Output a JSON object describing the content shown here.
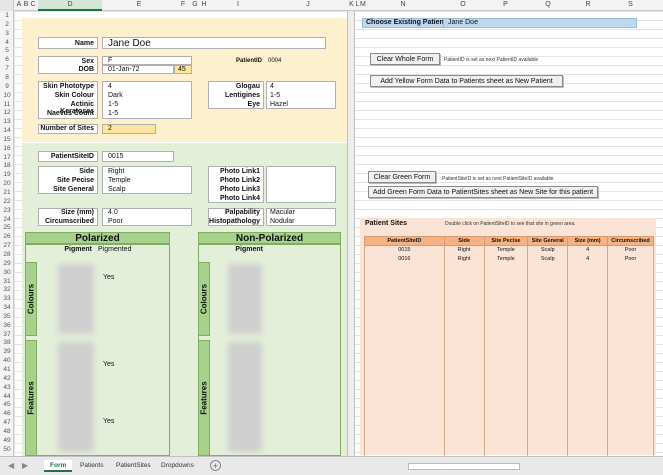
{
  "columns": [
    "A",
    "B",
    "C",
    "D",
    "E",
    "F",
    "G",
    "H",
    "I",
    "J",
    "K",
    "L",
    "M",
    "N",
    "O",
    "P",
    "Q",
    "R",
    "S"
  ],
  "selected_column": "D",
  "rows": [
    "1",
    "2",
    "3",
    "4",
    "5",
    "6",
    "7",
    "8",
    "9",
    "10",
    "11",
    "12",
    "13",
    "14",
    "15",
    "16",
    "17",
    "18",
    "19",
    "20",
    "21",
    "22",
    "23",
    "24",
    "25",
    "26",
    "27",
    "28",
    "29",
    "30",
    "31",
    "32",
    "33",
    "34",
    "35",
    "36",
    "37",
    "38",
    "39",
    "40",
    "41",
    "42",
    "43",
    "44",
    "45",
    "46",
    "47",
    "48",
    "49",
    "50"
  ],
  "patient": {
    "name_label": "Name",
    "name": "Jane Doe",
    "sex_label": "Sex",
    "sex": "F",
    "dob_label": "DOB",
    "dob": "01-Jan-72",
    "age": "45",
    "patientid_label": "PatientID",
    "patientid": "0004",
    "skin_phototype_label": "Skin Phototype",
    "skin_phototype": "4",
    "skin_colour_label": "Skin Colour",
    "skin_colour": "Dark",
    "actinic_label": "Actinic Keratoses",
    "actinic": "1-5",
    "naevus_label": "Naevus Count",
    "naevus": "1-5",
    "glogau_label": "Glogau",
    "glogau": "4",
    "lentigines_label": "Lentigines",
    "lentigines": "1-5",
    "eye_label": "Eye",
    "eye": "Hazel",
    "sites_label": "Number of Sites",
    "sites": "2"
  },
  "site": {
    "sitepid_label": "PatientSiteID",
    "sitepid": "0015",
    "side_label": "Side",
    "side": "Right",
    "precise_label": "Site Pecise",
    "precise": "Temple",
    "general_label": "Site General",
    "general": "Scalp",
    "photo1": "Photo Link1",
    "photo2": "Photo Link2",
    "photo3": "Photo Link3",
    "photo4": "Photo Link4",
    "size_label": "Size (mm)",
    "size": "4.0",
    "circ_label": "Circumscribed",
    "circ": "Poor",
    "palp_label": "Palpability",
    "palp": "Macular",
    "histo_label": "Histopathology",
    "histo": "Nodular"
  },
  "polarized": {
    "title": "Polarized",
    "pigment_label": "Pigment",
    "pigment": "Pigmented",
    "colours_label": "Colours",
    "features_label": "Features",
    "yes1": "Yes",
    "yes2": "Yes",
    "yes3": "Yes"
  },
  "nonpolarized": {
    "title": "Non-Polarized",
    "pigment_label": "Pigment",
    "colours_label": "Colours",
    "features_label": "Features"
  },
  "right": {
    "choose_label": "Choose Existing Patient",
    "choose_value": "Jane Doe",
    "clear_whole": "Clear Whole Form",
    "clear_whole_note": "PatientID is set as next PatientID available",
    "add_patient": "Add Yellow Form Data to Patients sheet as New Patient",
    "clear_green": "Clear Green Form",
    "clear_green_note": "PatientSiteID is set as next PatientSiteID available",
    "add_site": "Add Green Form Data to PatientSites sheet as New Site for this patient",
    "sites_title": "Patient Sites",
    "sites_note": "Double click on PatientSiteID to see that site in green area."
  },
  "sites_table": {
    "headers": [
      "PatientSiteID",
      "Side",
      "Site Pecise",
      "Site General",
      "Size (mm)",
      "Circumscribed"
    ],
    "rows": [
      [
        "0015",
        "Right",
        "Temple",
        "Scalp",
        "4",
        "Poor"
      ],
      [
        "0016",
        "Right",
        "Temple",
        "Scalp",
        "4",
        "Poor"
      ]
    ]
  },
  "tabs": [
    "Form",
    "Patients",
    "PatientSites",
    "Dropdowns"
  ],
  "active_tab": "Form",
  "colors": {
    "yellow": "#fdf0cf",
    "green": "#e3efd9",
    "header_green": "#a9d18e",
    "blue": "#bdd7ee",
    "peach": "#fbe4d5",
    "table_header": "#f4b183",
    "excel_green": "#217346"
  }
}
